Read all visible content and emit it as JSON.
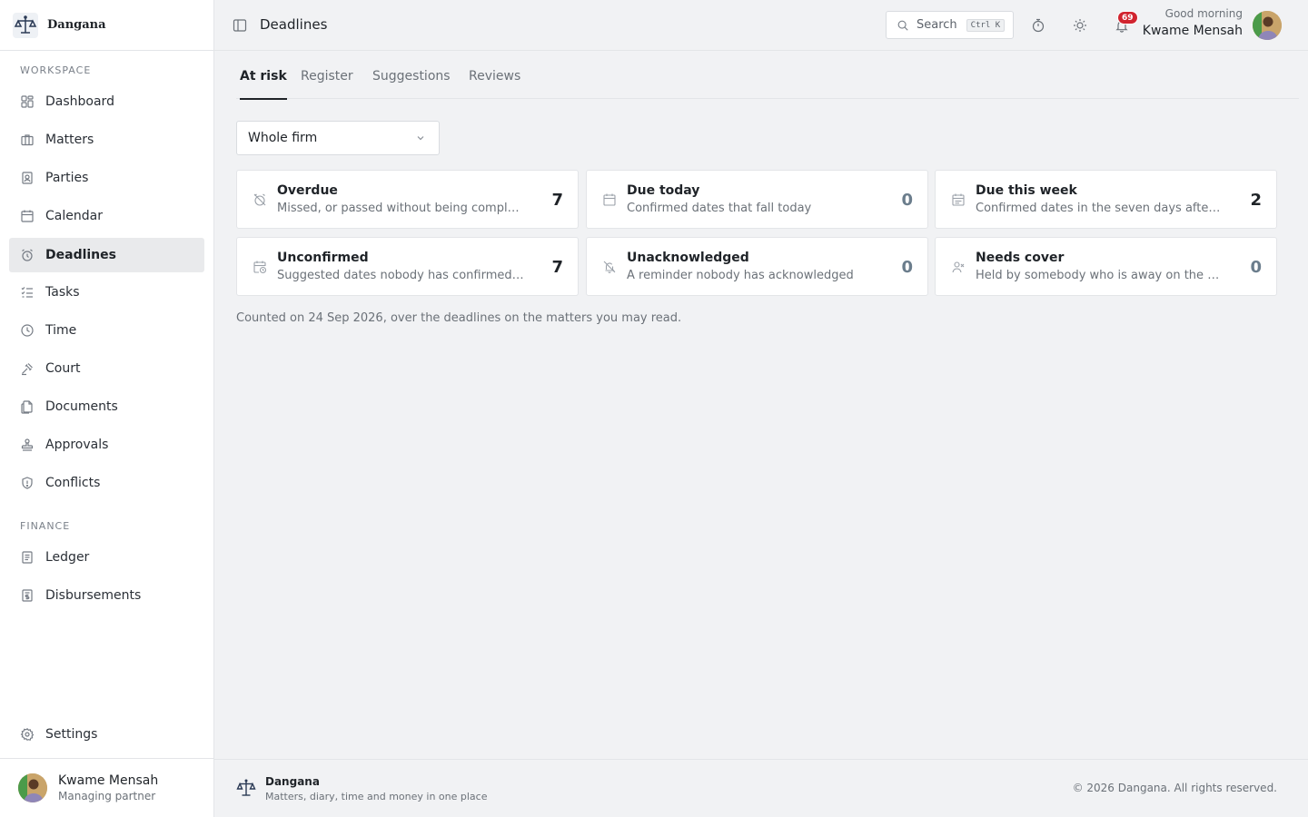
{
  "brand": {
    "name": "Dangana"
  },
  "sidebar": {
    "workspace_title": "WORKSPACE",
    "workspace_items": [
      {
        "label": "Dashboard",
        "icon": "dashboard-icon"
      },
      {
        "label": "Matters",
        "icon": "briefcase-icon"
      },
      {
        "label": "Parties",
        "icon": "contact-card-icon"
      },
      {
        "label": "Calendar",
        "icon": "calendar-icon"
      },
      {
        "label": "Deadlines",
        "icon": "alarm-clock-icon",
        "active": true
      },
      {
        "label": "Tasks",
        "icon": "task-list-icon"
      },
      {
        "label": "Time",
        "icon": "clock-icon"
      },
      {
        "label": "Court",
        "icon": "gavel-icon"
      },
      {
        "label": "Documents",
        "icon": "documents-icon"
      },
      {
        "label": "Approvals",
        "icon": "stamp-icon"
      },
      {
        "label": "Conflicts",
        "icon": "shield-icon"
      }
    ],
    "finance_title": "FINANCE",
    "finance_items": [
      {
        "label": "Ledger",
        "icon": "ledger-icon"
      },
      {
        "label": "Disbursements",
        "icon": "receipt-icon"
      }
    ],
    "settings_label": "Settings",
    "user": {
      "name": "Kwame Mensah",
      "role": "Managing partner"
    }
  },
  "header": {
    "title": "Deadlines",
    "search_label": "Search",
    "search_shortcut": "Ctrl K",
    "notification_count": "69",
    "greeting": "Good morning",
    "user_name": "Kwame Mensah"
  },
  "tabs": [
    {
      "label": "At risk",
      "active": true
    },
    {
      "label": "Register"
    },
    {
      "label": "Suggestions"
    },
    {
      "label": "Reviews"
    }
  ],
  "filter": {
    "selected": "Whole firm"
  },
  "cards": [
    {
      "title": "Overdue",
      "description": "Missed, or passed without being completed",
      "count": "7",
      "icon": "alarm-off-icon"
    },
    {
      "title": "Due today",
      "description": "Confirmed dates that fall today",
      "count": "0",
      "icon": "calendar-icon"
    },
    {
      "title": "Due this week",
      "description": "Confirmed dates in the seven days after today",
      "count": "2",
      "icon": "calendar-week-icon"
    },
    {
      "title": "Unconfirmed",
      "description": "Suggested dates nobody has confirmed or…",
      "count": "7",
      "icon": "calendar-clock-icon"
    },
    {
      "title": "Unacknowledged",
      "description": "A reminder nobody has acknowledged",
      "count": "0",
      "icon": "bell-off-icon"
    },
    {
      "title": "Needs cover",
      "description": "Held by somebody who is away on the date",
      "count": "0",
      "icon": "user-x-icon"
    }
  ],
  "counted_note": "Counted on 24 Sep 2026, over the deadlines on the matters you may read.",
  "footer": {
    "name": "Dangana",
    "tagline": "Matters, diary, time and money in one place",
    "copyright": "© 2026 Dangana. All rights reserved."
  },
  "colors": {
    "badge": "#d1242f",
    "active_nav_bg": "#e9eaec",
    "page_bg": "#f1f2f4"
  }
}
